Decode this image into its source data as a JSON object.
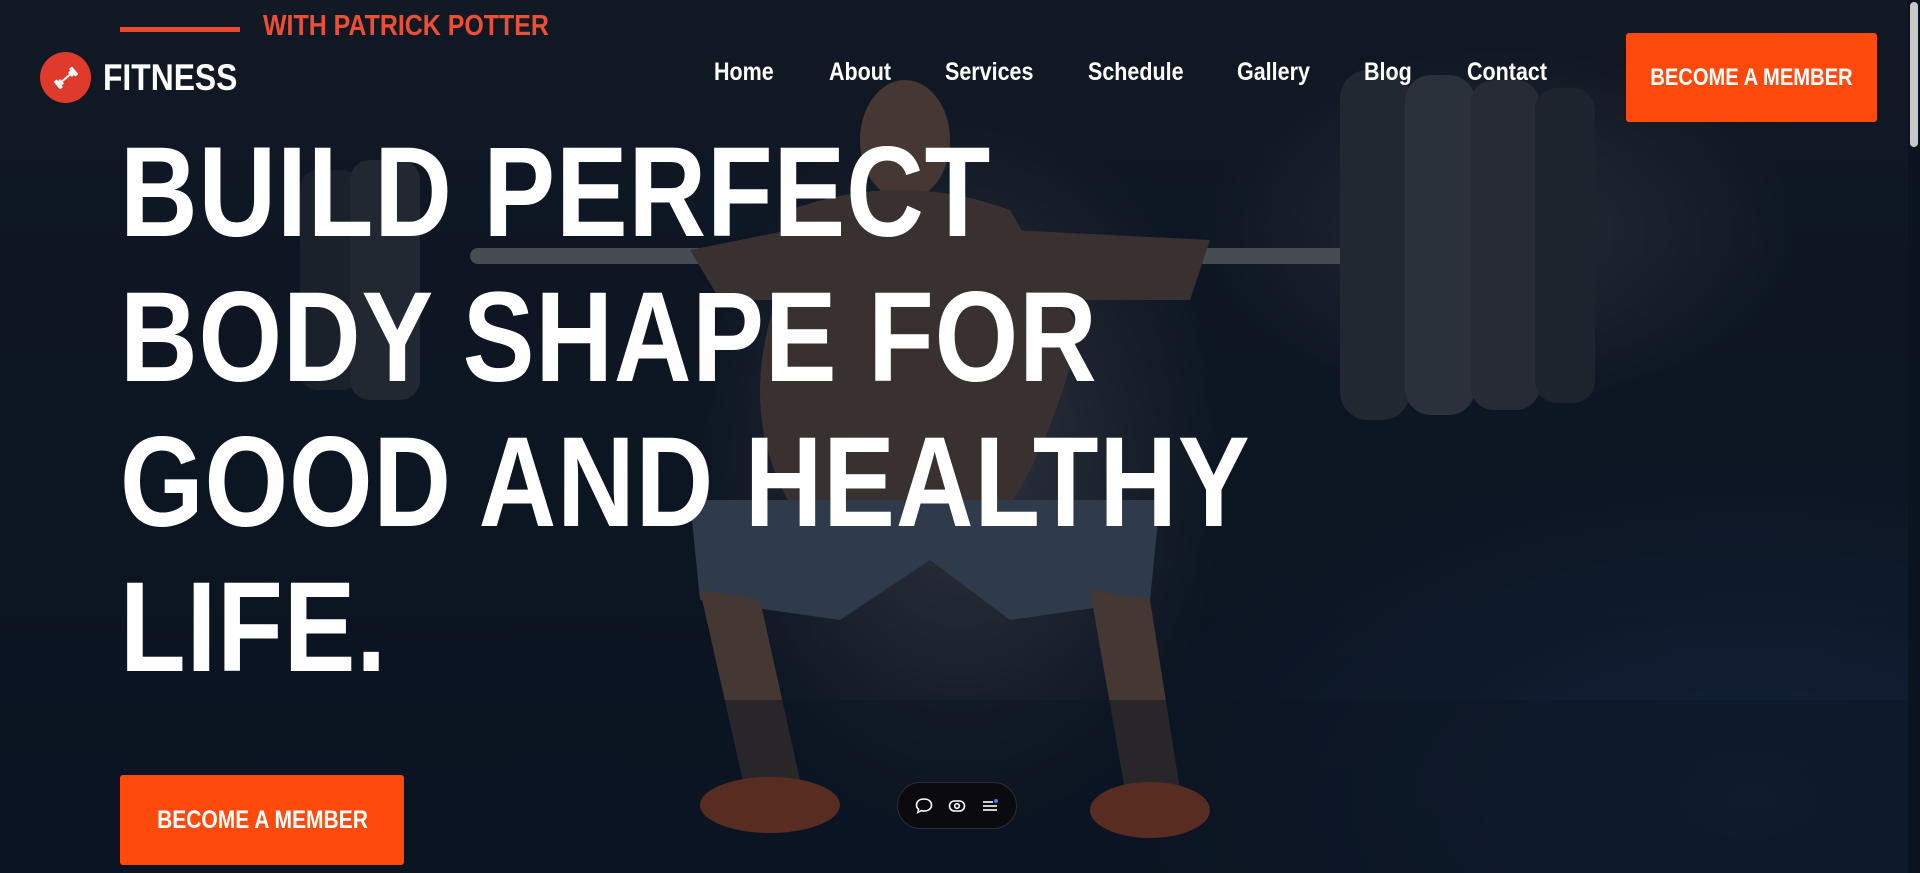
{
  "header": {
    "tagline": "WITH PATRICK POTTER",
    "logo_text": "FITNESS",
    "logo_icon": "dumbbell-icon",
    "nav": [
      {
        "label": "Home"
      },
      {
        "label": "About"
      },
      {
        "label": "Services"
      },
      {
        "label": "Schedule"
      },
      {
        "label": "Gallery"
      },
      {
        "label": "Blog"
      },
      {
        "label": "Contact"
      }
    ],
    "cta_label": "BECOME A MEMBER"
  },
  "hero": {
    "title_lines": [
      "BUILD PERFECT",
      "BODY SHAPE FOR",
      "GOOD AND HEALTHY",
      "LIFE."
    ],
    "cta_label": "BECOME A MEMBER"
  },
  "floating_toolbar": {
    "icons": [
      "chat-bubble-icon",
      "eye-icon",
      "menu-list-icon"
    ]
  },
  "colors": {
    "accent": "#ff4a0d",
    "tagline": "#ee4f34",
    "logo_badge": "#e03a2c",
    "background": "#0c1624"
  }
}
